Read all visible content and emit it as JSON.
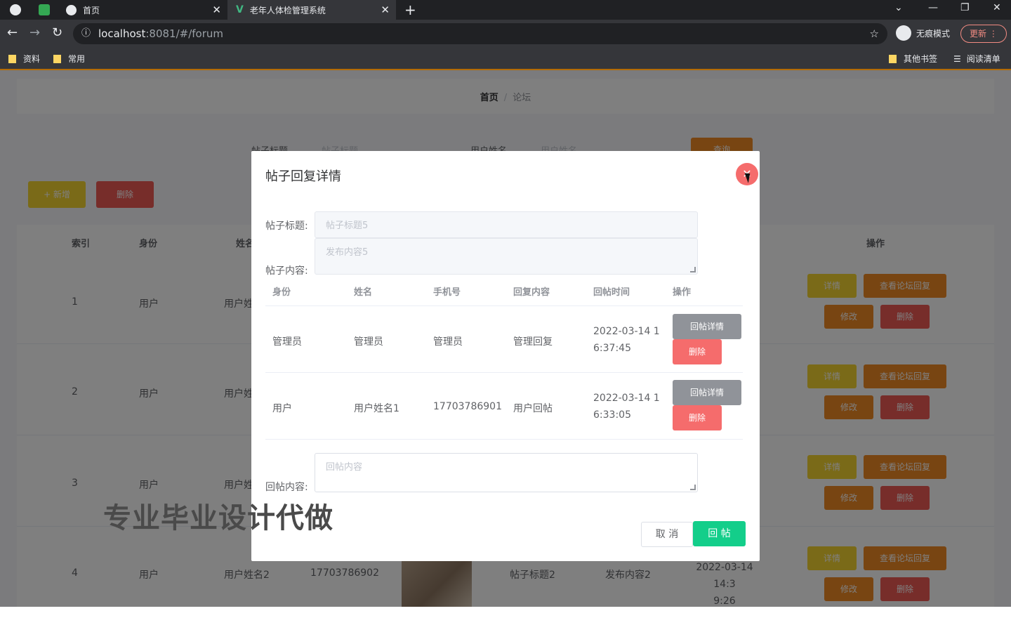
{
  "browser": {
    "tabs": [
      {
        "title": "首页"
      },
      {
        "title": "老年人体检管理系统"
      }
    ],
    "url_host": "localhost",
    "url_rest": ":8081/#/forum",
    "incognito_label": "无痕模式",
    "update_label": "更新",
    "bookmarks_left": [
      "资料",
      "常用"
    ],
    "bookmarks_right": [
      "其他书签",
      "阅读清单"
    ]
  },
  "page": {
    "breadcrumb": {
      "home": "首页",
      "separator": "/",
      "current": "论坛"
    },
    "search": {
      "title_label": "帖子标题",
      "title_placeholder": "帖子标题",
      "user_label": "用户姓名",
      "user_placeholder": "用户姓名",
      "button": "查询"
    },
    "actions": {
      "add": "+ 新增",
      "delete": "删除"
    },
    "table": {
      "headers": [
        "索引",
        "身份",
        "姓名",
        "操作"
      ],
      "rows": [
        {
          "index": "1",
          "identity": "用户",
          "name": "用户姓"
        },
        {
          "index": "2",
          "identity": "用户",
          "name": "用户姓"
        },
        {
          "index": "3",
          "identity": "用户",
          "name": "用户姓"
        },
        {
          "index": "4",
          "identity": "用户",
          "name": "用户姓名2",
          "phone": "17703786902",
          "title": "帖子标题2",
          "content": "发布内容2",
          "time_line1": "2022-03-14 14:3",
          "time_line2": "9:26"
        }
      ],
      "row_buttons": {
        "detail": "详情",
        "view_replies": "查看论坛回复",
        "edit": "修改",
        "delete": "删除"
      }
    }
  },
  "modal": {
    "title": "帖子回复详情",
    "post_title_label": "帖子标题:",
    "post_title_value": "帖子标题5",
    "post_content_label": "帖子内容:",
    "post_content_value": "发布内容5",
    "reply_table": {
      "headers": [
        "身份",
        "姓名",
        "手机号",
        "回复内容",
        "回帖时间",
        "操作"
      ],
      "rows": [
        {
          "identity": "管理员",
          "name": "管理员",
          "phone": "管理员",
          "content": "管理回复",
          "time_line1": "2022-03-14 1",
          "time_line2": "6:37:45"
        },
        {
          "identity": "用户",
          "name": "用户姓名1",
          "phone": "17703786901",
          "content": "用户回帖",
          "time_line1": "2022-03-14 1",
          "time_line2": "6:33:05"
        }
      ],
      "detail_button": "回帖详情",
      "delete_button": "删除"
    },
    "reply_label": "回帖内容:",
    "reply_placeholder": "回帖内容",
    "cancel": "取 消",
    "submit": "回 帖"
  },
  "watermark": "专业毕业设计代做",
  "colors": {
    "primary_green": "#13ce8a",
    "danger": "#f56c6c",
    "info_gray": "#909399",
    "warning_orange": "#f08a24",
    "yellow": "#f5d430"
  }
}
